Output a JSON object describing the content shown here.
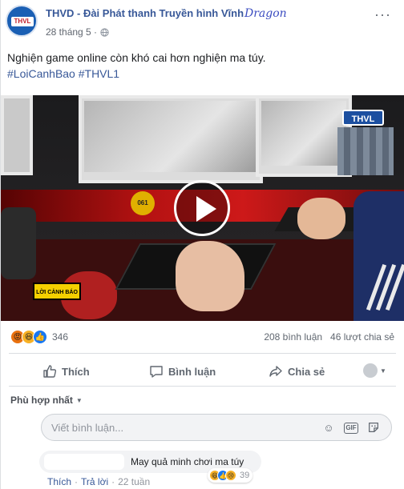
{
  "header": {
    "page_name": "THVD - Đài Phát thanh Truyền hình Vĩnh",
    "handwritten_overlay": "Dragon",
    "timestamp": "28 tháng 5 ·",
    "avatar_logo": "THVL",
    "more_icon": "ellipsis-icon"
  },
  "post": {
    "text": "Nghiện game online còn khó cai hơn nghiện ma túy.",
    "hashtags": "#LoiCanhBao #THVL1"
  },
  "video": {
    "channel_logo": "THVL",
    "warning_badge": "LỜI CẢNH BÁO",
    "sticker_label": "061",
    "play_icon": "play-icon"
  },
  "stats": {
    "reaction_icons": [
      "angry-icon",
      "haha-icon",
      "like-icon"
    ],
    "reaction_count": "346",
    "comments": "208 bình luận",
    "shares": "46 lượt chia sẻ"
  },
  "actions": {
    "like": "Thích",
    "comment": "Bình luận",
    "share": "Chia sẻ"
  },
  "comments": {
    "sort_label": "Phù hợp nhất",
    "input_placeholder": "Viết bình luận...",
    "input_icons": [
      "emoji-icon",
      "gif-icon",
      "sticker-icon"
    ],
    "items": [
      {
        "text": "May quả minh chơi ma túy",
        "reaction_count": "39",
        "actions": {
          "like": "Thích",
          "reply": "Trả lời",
          "time": "22 tuần"
        }
      }
    ]
  },
  "colors": {
    "link_blue": "#385898",
    "like_blue": "#1877f2",
    "muted_gray": "#606770",
    "border": "#dddfe2"
  }
}
